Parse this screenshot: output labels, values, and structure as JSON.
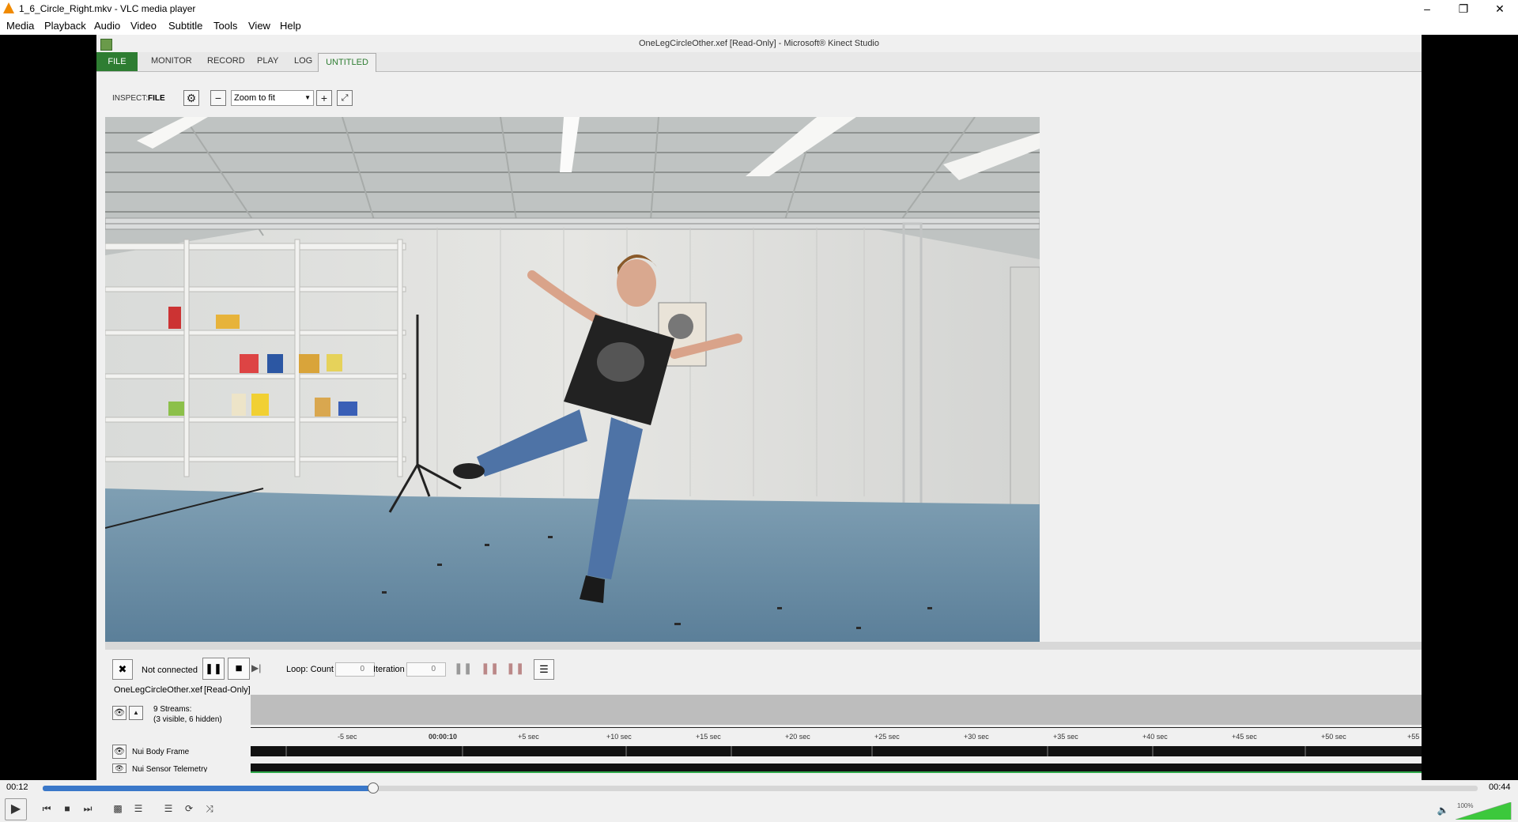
{
  "vlc": {
    "window_title": "1_6_Circle_Right.mkv - VLC media player",
    "menu": [
      "Media",
      "Playback",
      "Audio",
      "Video",
      "Subtitle",
      "Tools",
      "View",
      "Help"
    ],
    "time_elapsed": "00:12",
    "time_total": "00:44",
    "seek_progress": 0.23,
    "volume_label": "100%",
    "volume_level": 1.0
  },
  "kinect": {
    "window_title": "OneLegCircleOther.xef [Read-Only] - Microsoft® Kinect Studio",
    "tabs": [
      "FILE",
      "MONITOR",
      "RECORD",
      "PLAY",
      "LOG",
      "UNTITLED"
    ],
    "inspect_label": "INSPECT:",
    "inspect_value": "FILE",
    "zoom_value": "Zoom to fit",
    "status": "Not connected",
    "loop_label": "Loop: Count",
    "loop_count": "0",
    "iteration_label": "Iteration",
    "iteration_value": "0",
    "file_name": "OneLegCircleOther.xef",
    "file_readonly": "[Read-Only]",
    "streams_line1": "9 Streams:",
    "streams_line2": "(3 visible, 6 hidden)",
    "ticks": [
      "-5 sec",
      "00:00:10",
      "+5 sec",
      "+10 sec",
      "+15 sec",
      "+20 sec",
      "+25 sec",
      "+30 sec",
      "+35 sec",
      "+40 sec",
      "+45 sec",
      "+50 sec",
      "+55"
    ],
    "track1_name": "Nui Body Frame",
    "track2_name": "Nui Sensor Telemetry"
  },
  "colors": {
    "kinect_green": "#2e7d32",
    "vlc_seek": "#3a78c9",
    "vlc_volume": "#3cc83c"
  }
}
